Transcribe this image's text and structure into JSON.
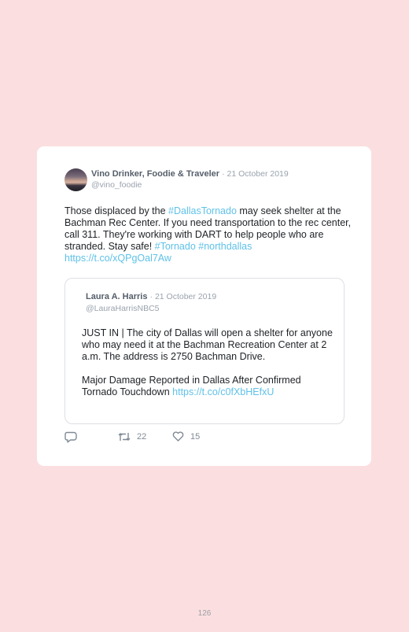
{
  "tweet": {
    "author_name": "Vino Drinker, Foodie & Traveler",
    "date": "· 21 October 2019",
    "handle": "@vino_foodie",
    "text_1": "Those displaced by the ",
    "hashtag_1": "#DallasTornado",
    "text_2": " may seek shelter at the Bachman Rec Center. If you need transportation to the rec center, call 311. They're working with DART to help people who are stranded. Stay safe! ",
    "hashtag_2": "#Tornado",
    "hashtag_3": "#northdallas",
    "link": "https://t.co/xQPgOal7Aw"
  },
  "quoted_tweet": {
    "author_name": "Laura A. Harris",
    "date": "· 21 October 2019",
    "handle": "@LauraHarrisNBC5",
    "paragraph_1": "JUST IN | The city of Dallas will open a shelter for anyone who may need it at the Bachman Recreation Center at 2 a.m. The address is 2750 Bachman Drive.",
    "paragraph_2_text": "Major Damage Reported in Dallas After Confirmed Tornado Touchdown ",
    "paragraph_2_link": "https://t.co/c0fXbHEfxU"
  },
  "actions": {
    "reply_icon": "reply-icon",
    "retweet_icon": "retweet-icon",
    "retweet_count": "22",
    "like_icon": "heart-icon",
    "like_count": "15"
  },
  "page_number": "126"
}
